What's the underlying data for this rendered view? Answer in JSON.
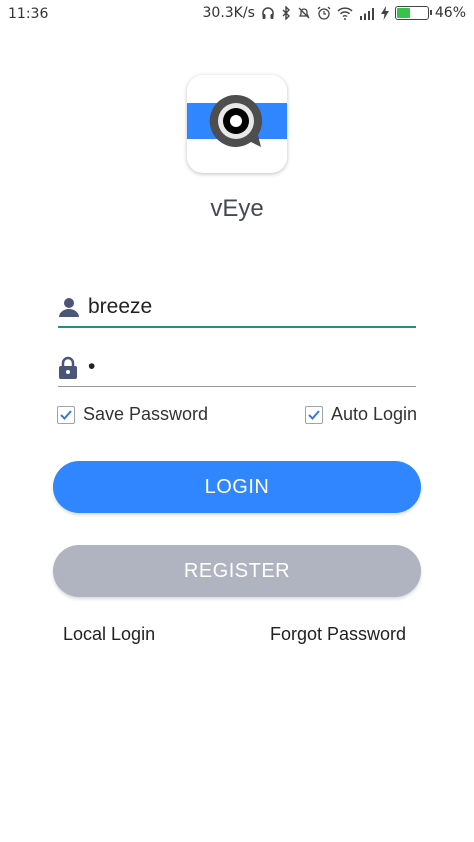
{
  "status_bar": {
    "time": "11:36",
    "net_speed": "30.3K/s",
    "battery_percent": "46%",
    "battery_level": 0.46,
    "icons": [
      "headphones-icon",
      "bluetooth-icon",
      "mute-icon",
      "alarm-icon",
      "wifi-icon",
      "signal-icon",
      "charging-icon",
      "battery-icon"
    ]
  },
  "app": {
    "name": "vEye",
    "logo_icon": "camera-logo-icon"
  },
  "form": {
    "username_value": "breeze",
    "password_value": "•",
    "username_icon": "user-icon",
    "password_icon": "lock-icon"
  },
  "options": {
    "save_password_label": "Save Password",
    "save_password_checked": true,
    "auto_login_label": "Auto Login",
    "auto_login_checked": true
  },
  "buttons": {
    "login_label": "LOGIN",
    "register_label": "REGISTER"
  },
  "links": {
    "local_login": "Local Login",
    "forgot_password": "Forgot Password"
  },
  "colors": {
    "primary": "#2f86ff",
    "register": "#b0b4c0",
    "username_underline": "#1f8f7e",
    "icon": "#4a5578",
    "battery": "#37c34b"
  }
}
